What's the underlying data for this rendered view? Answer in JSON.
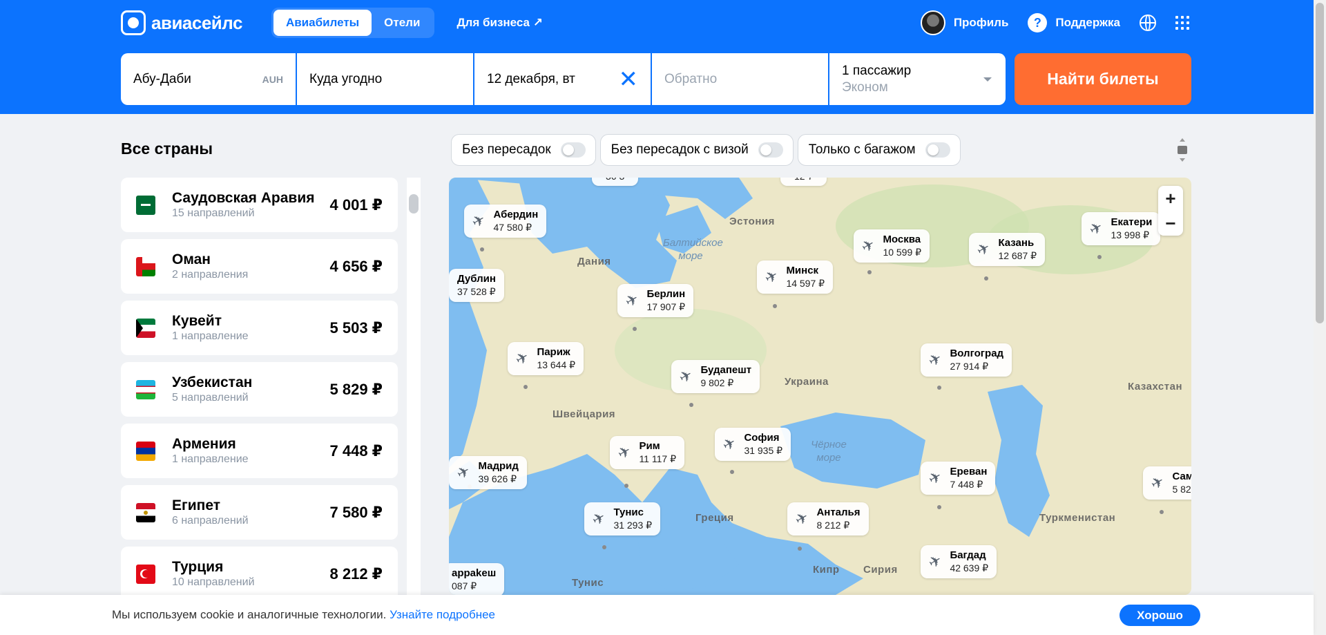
{
  "header": {
    "logo_text": "авиасейлс",
    "tabs": [
      {
        "label": "Авиабилеты",
        "active": true
      },
      {
        "label": "Отели",
        "active": false
      }
    ],
    "business_link": "Для бизнеса ↗",
    "profile_label": "Профиль",
    "support_label": "Поддержка",
    "accent_color": "#0c73fe"
  },
  "search": {
    "origin": "Абу-Даби",
    "origin_code": "AUH",
    "destination": "Куда угодно",
    "depart_date": "12 декабря, вт",
    "return_placeholder": "Обратно",
    "passengers": "1 пассажир",
    "cabin_class": "Эконом",
    "find_button": "Найти билеты",
    "find_button_color": "#ff6d31"
  },
  "list": {
    "title": "Все страны",
    "countries": [
      {
        "name": "Саудовская Аравия",
        "sub": "15 направлений",
        "price": "4 001 ₽",
        "flag": "sa"
      },
      {
        "name": "Оман",
        "sub": "2 направления",
        "price": "4 656 ₽",
        "flag": "om"
      },
      {
        "name": "Кувейт",
        "sub": "1 направление",
        "price": "5 503 ₽",
        "flag": "kw"
      },
      {
        "name": "Узбекистан",
        "sub": "5 направлений",
        "price": "5 829 ₽",
        "flag": "uz"
      },
      {
        "name": "Армения",
        "sub": "1 направление",
        "price": "7 448 ₽",
        "flag": "am"
      },
      {
        "name": "Египет",
        "sub": "6 направлений",
        "price": "7 580 ₽",
        "flag": "eg"
      },
      {
        "name": "Турция",
        "sub": "10 направлений",
        "price": "8 212 ₽",
        "flag": "tr"
      }
    ]
  },
  "filters": [
    {
      "label": "Без пересадок",
      "on": false
    },
    {
      "label": "Без пересадок с визой",
      "on": false
    },
    {
      "label": "Только с багажом",
      "on": false
    }
  ],
  "map": {
    "regions": [
      "Эстония",
      "Дания",
      "Украина",
      "Казахстан",
      "Швейцария",
      "Греция",
      "Туркменистан",
      "Тунис",
      "Кипр",
      "Сирия"
    ],
    "seas": [
      "Балтийское море",
      "Чёрное море"
    ],
    "pins": [
      {
        "city": "Абердин",
        "price": "47 580 ₽"
      },
      {
        "city": "Москва",
        "price": "10 599 ₽"
      },
      {
        "city": "Казань",
        "price": "12 687 ₽"
      },
      {
        "city": "Екатери",
        "price": "13 998 ₽"
      },
      {
        "city": "Дублин",
        "price": "37 528 ₽"
      },
      {
        "city": "Минск",
        "price": "14 597 ₽"
      },
      {
        "city": "Берлин",
        "price": "17 907 ₽"
      },
      {
        "city": "Париж",
        "price": "13 644 ₽"
      },
      {
        "city": "Будапешт",
        "price": "9 802 ₽"
      },
      {
        "city": "Волгоград",
        "price": "27 914 ₽"
      },
      {
        "city": "Рим",
        "price": "11 117 ₽"
      },
      {
        "city": "София",
        "price": "31 935 ₽"
      },
      {
        "city": "Мадрид",
        "price": "39 626 ₽"
      },
      {
        "city": "Ереван",
        "price": "7 448 ₽"
      },
      {
        "city": "Сам",
        "price": "5 82"
      },
      {
        "city": "Тунис",
        "price": "31 293 ₽"
      },
      {
        "city": "Анталья",
        "price": "8 212 ₽"
      },
      {
        "city": "Багдад",
        "price": "42 639 ₽"
      },
      {
        "city": "аррakеш",
        "price": "087 ₽"
      }
    ],
    "zoom_in": "+",
    "zoom_out": "−"
  },
  "cookie": {
    "text": "Мы используем cookie и аналогичные технологии.",
    "link": "Узнайте подробнее",
    "button": "Хорошо"
  }
}
